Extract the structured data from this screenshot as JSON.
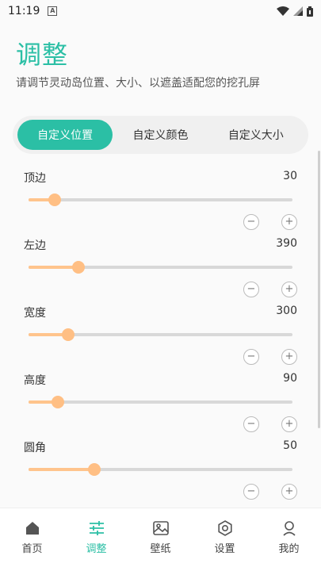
{
  "status": {
    "time": "11:19"
  },
  "header": {
    "title": "调整",
    "subtitle": "请调节灵动岛位置、大小、以遮盖适配您的挖孔屏"
  },
  "tabs": [
    {
      "label": "自定义位置",
      "active": true
    },
    {
      "label": "自定义颜色",
      "active": false
    },
    {
      "label": "自定义大小",
      "active": false
    }
  ],
  "sliders": [
    {
      "label": "顶边",
      "value": "30",
      "level": 0.1
    },
    {
      "label": "左边",
      "value": "390",
      "level": 0.19
    },
    {
      "label": "宽度",
      "value": "300",
      "level": 0.15
    },
    {
      "label": "高度",
      "value": "90",
      "level": 0.11
    },
    {
      "label": "圆角",
      "value": "50",
      "level": 0.25
    }
  ],
  "stepper": {
    "minus": "−",
    "plus": "+"
  },
  "nav": [
    {
      "label": "首页",
      "icon": "home-icon",
      "active": false
    },
    {
      "label": "调整",
      "icon": "sliders-icon",
      "active": true
    },
    {
      "label": "壁纸",
      "icon": "image-icon",
      "active": false
    },
    {
      "label": "设置",
      "icon": "gear-icon",
      "active": false
    },
    {
      "label": "我的",
      "icon": "person-icon",
      "active": false
    }
  ],
  "colors": {
    "accent": "#2bbfa5",
    "slider_fill": "#ffc48c",
    "track": "#d8d8d8"
  }
}
